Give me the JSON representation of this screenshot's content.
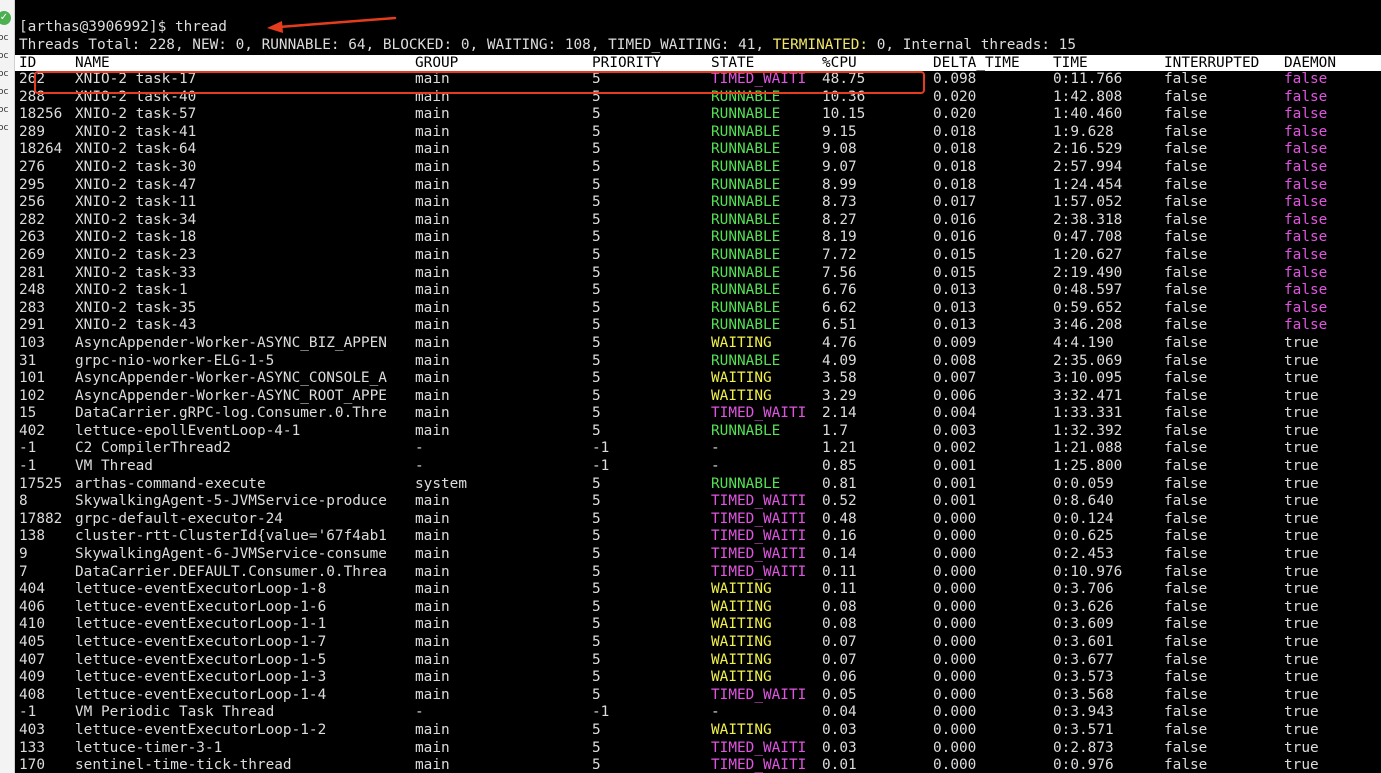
{
  "sidebar": {
    "labels": [
      "oc",
      "oc",
      "oc",
      "oc",
      "oc",
      "oc"
    ]
  },
  "terminal": {
    "prompt": "[arthas@3906992]$ ",
    "command": "thread",
    "summary": {
      "prefix": "Threads Total: 228, NEW: 0, RUNNABLE: 64, BLOCKED: 0, WAITING: 108, TIMED_WAITING: 41, ",
      "terminated_word": "TERMINATED:",
      "suffix": " 0, Internal threads: 15"
    },
    "columns": [
      "ID",
      "NAME",
      "GROUP",
      "PRIORITY",
      "STATE",
      "%CPU",
      "DELTA_TIME",
      "TIME",
      "INTERRUPTED",
      "DAEMON"
    ],
    "rows": [
      [
        "262",
        "XNIO-2 task-17",
        "main",
        "5",
        "TIMED_WAITI",
        "48.75",
        "0.098",
        "0:11.766",
        "false",
        "false"
      ],
      [
        "288",
        "XNIO-2 task-40",
        "main",
        "5",
        "RUNNABLE",
        "10.36",
        "0.020",
        "1:42.808",
        "false",
        "false"
      ],
      [
        "18256",
        "XNIO-2 task-57",
        "main",
        "5",
        "RUNNABLE",
        "10.15",
        "0.020",
        "1:40.460",
        "false",
        "false"
      ],
      [
        "289",
        "XNIO-2 task-41",
        "main",
        "5",
        "RUNNABLE",
        "9.15",
        "0.018",
        "1:9.628",
        "false",
        "false"
      ],
      [
        "18264",
        "XNIO-2 task-64",
        "main",
        "5",
        "RUNNABLE",
        "9.08",
        "0.018",
        "2:16.529",
        "false",
        "false"
      ],
      [
        "276",
        "XNIO-2 task-30",
        "main",
        "5",
        "RUNNABLE",
        "9.07",
        "0.018",
        "2:57.994",
        "false",
        "false"
      ],
      [
        "295",
        "XNIO-2 task-47",
        "main",
        "5",
        "RUNNABLE",
        "8.99",
        "0.018",
        "1:24.454",
        "false",
        "false"
      ],
      [
        "256",
        "XNIO-2 task-11",
        "main",
        "5",
        "RUNNABLE",
        "8.73",
        "0.017",
        "1:57.052",
        "false",
        "false"
      ],
      [
        "282",
        "XNIO-2 task-34",
        "main",
        "5",
        "RUNNABLE",
        "8.27",
        "0.016",
        "2:38.318",
        "false",
        "false"
      ],
      [
        "263",
        "XNIO-2 task-18",
        "main",
        "5",
        "RUNNABLE",
        "8.19",
        "0.016",
        "0:47.708",
        "false",
        "false"
      ],
      [
        "269",
        "XNIO-2 task-23",
        "main",
        "5",
        "RUNNABLE",
        "7.72",
        "0.015",
        "1:20.627",
        "false",
        "false"
      ],
      [
        "281",
        "XNIO-2 task-33",
        "main",
        "5",
        "RUNNABLE",
        "7.56",
        "0.015",
        "2:19.490",
        "false",
        "false"
      ],
      [
        "248",
        "XNIO-2 task-1",
        "main",
        "5",
        "RUNNABLE",
        "6.76",
        "0.013",
        "0:48.597",
        "false",
        "false"
      ],
      [
        "283",
        "XNIO-2 task-35",
        "main",
        "5",
        "RUNNABLE",
        "6.62",
        "0.013",
        "0:59.652",
        "false",
        "false"
      ],
      [
        "291",
        "XNIO-2 task-43",
        "main",
        "5",
        "RUNNABLE",
        "6.51",
        "0.013",
        "3:46.208",
        "false",
        "false"
      ],
      [
        "103",
        "AsyncAppender-Worker-ASYNC_BIZ_APPEN",
        "main",
        "5",
        "WAITING",
        "4.76",
        "0.009",
        "4:4.190",
        "false",
        "true"
      ],
      [
        "31",
        "grpc-nio-worker-ELG-1-5",
        "main",
        "5",
        "RUNNABLE",
        "4.09",
        "0.008",
        "2:35.069",
        "false",
        "true"
      ],
      [
        "101",
        "AsyncAppender-Worker-ASYNC_CONSOLE_A",
        "main",
        "5",
        "WAITING",
        "3.58",
        "0.007",
        "3:10.095",
        "false",
        "true"
      ],
      [
        "102",
        "AsyncAppender-Worker-ASYNC_ROOT_APPE",
        "main",
        "5",
        "WAITING",
        "3.29",
        "0.006",
        "3:32.471",
        "false",
        "true"
      ],
      [
        "15",
        "DataCarrier.gRPC-log.Consumer.0.Thre",
        "main",
        "5",
        "TIMED_WAITI",
        "2.14",
        "0.004",
        "1:33.331",
        "false",
        "true"
      ],
      [
        "402",
        "lettuce-epollEventLoop-4-1",
        "main",
        "5",
        "RUNNABLE",
        "1.7",
        "0.003",
        "1:32.392",
        "false",
        "true"
      ],
      [
        "-1",
        "C2 CompilerThread2",
        "-",
        "-1",
        "-",
        "1.21",
        "0.002",
        "1:21.088",
        "false",
        "true"
      ],
      [
        "-1",
        "VM Thread",
        "-",
        "-1",
        "-",
        "0.85",
        "0.001",
        "1:25.800",
        "false",
        "true"
      ],
      [
        "17525",
        "arthas-command-execute",
        "system",
        "5",
        "RUNNABLE",
        "0.81",
        "0.001",
        "0:0.059",
        "false",
        "true"
      ],
      [
        "8",
        "SkywalkingAgent-5-JVMService-produce",
        "main",
        "5",
        "TIMED_WAITI",
        "0.52",
        "0.001",
        "0:8.640",
        "false",
        "true"
      ],
      [
        "17882",
        "grpc-default-executor-24",
        "main",
        "5",
        "TIMED_WAITI",
        "0.48",
        "0.000",
        "0:0.124",
        "false",
        "true"
      ],
      [
        "138",
        "cluster-rtt-ClusterId{value='67f4ab1",
        "main",
        "5",
        "TIMED_WAITI",
        "0.16",
        "0.000",
        "0:0.625",
        "false",
        "true"
      ],
      [
        "9",
        "SkywalkingAgent-6-JVMService-consume",
        "main",
        "5",
        "TIMED_WAITI",
        "0.14",
        "0.000",
        "0:2.453",
        "false",
        "true"
      ],
      [
        "7",
        "DataCarrier.DEFAULT.Consumer.0.Threa",
        "main",
        "5",
        "TIMED_WAITI",
        "0.11",
        "0.000",
        "0:10.976",
        "false",
        "true"
      ],
      [
        "404",
        "lettuce-eventExecutorLoop-1-8",
        "main",
        "5",
        "WAITING",
        "0.11",
        "0.000",
        "0:3.706",
        "false",
        "true"
      ],
      [
        "406",
        "lettuce-eventExecutorLoop-1-6",
        "main",
        "5",
        "WAITING",
        "0.08",
        "0.000",
        "0:3.626",
        "false",
        "true"
      ],
      [
        "410",
        "lettuce-eventExecutorLoop-1-1",
        "main",
        "5",
        "WAITING",
        "0.08",
        "0.000",
        "0:3.609",
        "false",
        "true"
      ],
      [
        "405",
        "lettuce-eventExecutorLoop-1-7",
        "main",
        "5",
        "WAITING",
        "0.07",
        "0.000",
        "0:3.601",
        "false",
        "true"
      ],
      [
        "407",
        "lettuce-eventExecutorLoop-1-5",
        "main",
        "5",
        "WAITING",
        "0.07",
        "0.000",
        "0:3.677",
        "false",
        "true"
      ],
      [
        "409",
        "lettuce-eventExecutorLoop-1-3",
        "main",
        "5",
        "WAITING",
        "0.06",
        "0.000",
        "0:3.573",
        "false",
        "true"
      ],
      [
        "408",
        "lettuce-eventExecutorLoop-1-4",
        "main",
        "5",
        "TIMED_WAITI",
        "0.05",
        "0.000",
        "0:3.568",
        "false",
        "true"
      ],
      [
        "-1",
        "VM Periodic Task Thread",
        "-",
        "-1",
        "-",
        "0.04",
        "0.000",
        "0:3.943",
        "false",
        "true"
      ],
      [
        "403",
        "lettuce-eventExecutorLoop-1-2",
        "main",
        "5",
        "WAITING",
        "0.03",
        "0.000",
        "0:3.571",
        "false",
        "true"
      ],
      [
        "133",
        "lettuce-timer-3-1",
        "main",
        "5",
        "TIMED_WAITI",
        "0.03",
        "0.000",
        "0:2.873",
        "false",
        "true"
      ],
      [
        "170",
        "sentinel-time-tick-thread",
        "main",
        "5",
        "TIMED_WAITI",
        "0.01",
        "0.000",
        "0:0.976",
        "false",
        "true"
      ]
    ]
  },
  "annotation": {
    "highlight_row_index": 0,
    "color": "#e63c1e"
  },
  "colors": {
    "runnable": "#55e055",
    "waiting": "#f0f04a",
    "timed_waiting": "#e055e0",
    "daemon_false": "#e055e0",
    "terminal_bg": "#000000",
    "terminal_fg": "#dcdcdc"
  }
}
